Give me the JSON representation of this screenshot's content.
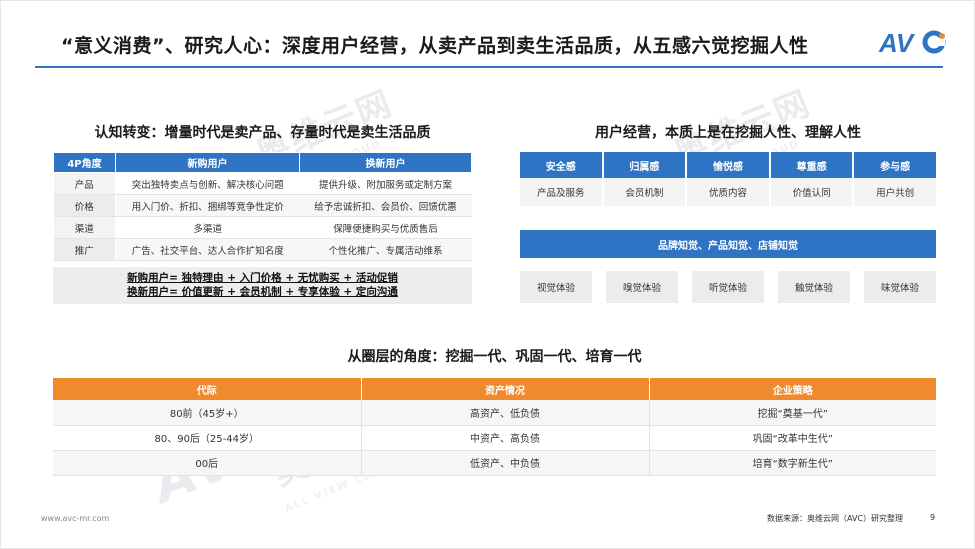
{
  "slide": {
    "title": "“意义消费”、研究人心：深度用户经营，从卖产品到卖生活品质，从五感六觉挖掘人性",
    "logo_text": "AVC",
    "watermark_text": "奥维云网",
    "watermark_sub": "ALL VIEW CLOUD"
  },
  "left": {
    "title": "认知转变：增量时代是卖产品、存量时代是卖生活品质",
    "headers": [
      "4P角度",
      "新购用户",
      "换新用户"
    ],
    "rows": [
      [
        "产品",
        "突出独特卖点与创新、解决核心问题",
        "提供升级、附加服务或定制方案"
      ],
      [
        "价格",
        "用入门价、折扣、捆绑等竞争性定价",
        "给予忠诚折扣、会员价、回馈优惠"
      ],
      [
        "渠道",
        "多渠道",
        "保障便捷购买与优质售后"
      ],
      [
        "推广",
        "广告、社交平台、达人合作扩知名度",
        "个性化推广、专属活动维系"
      ]
    ],
    "summary": [
      "新购用户= 独特理由 + 入门价格 + 无忧购买 + 活动促销",
      "换新用户= 价值更新 + 会员机制 + 专享体验 + 定向沟通"
    ]
  },
  "right": {
    "title": "用户经营，本质上是在挖掘人性、理解人性",
    "headers": [
      "安全感",
      "归属感",
      "愉悦感",
      "尊重感",
      "参与感"
    ],
    "values": [
      "产品及服务",
      "会员机制",
      "优质内容",
      "价值认同",
      "用户共创"
    ],
    "banner": "品牌知觉、产品知觉、店铺知觉",
    "senses": [
      "视觉体验",
      "嗅觉体验",
      "听觉体验",
      "触觉体验",
      "味觉体验"
    ]
  },
  "bottom": {
    "title": "从圈层的角度：挖掘一代、巩固一代、培育一代",
    "headers": [
      "代际",
      "资产情况",
      "企业策略"
    ],
    "rows": [
      [
        "80前（45岁+）",
        "高资产、低负债",
        "挖掘“奠基一代”"
      ],
      [
        "80、90后（25-44岁）",
        "中资产、高负债",
        "巩固“改革中生代”"
      ],
      [
        "00后",
        "低资产、中负债",
        "培育“数字新生代”"
      ]
    ]
  },
  "footer": {
    "website": "www.avc-mr.com",
    "source": "数据来源：奥维云网（AVC）研究整理",
    "page": "9"
  },
  "colors": {
    "accent_blue": "#2f74c4",
    "accent_orange": "#f08a2e"
  }
}
